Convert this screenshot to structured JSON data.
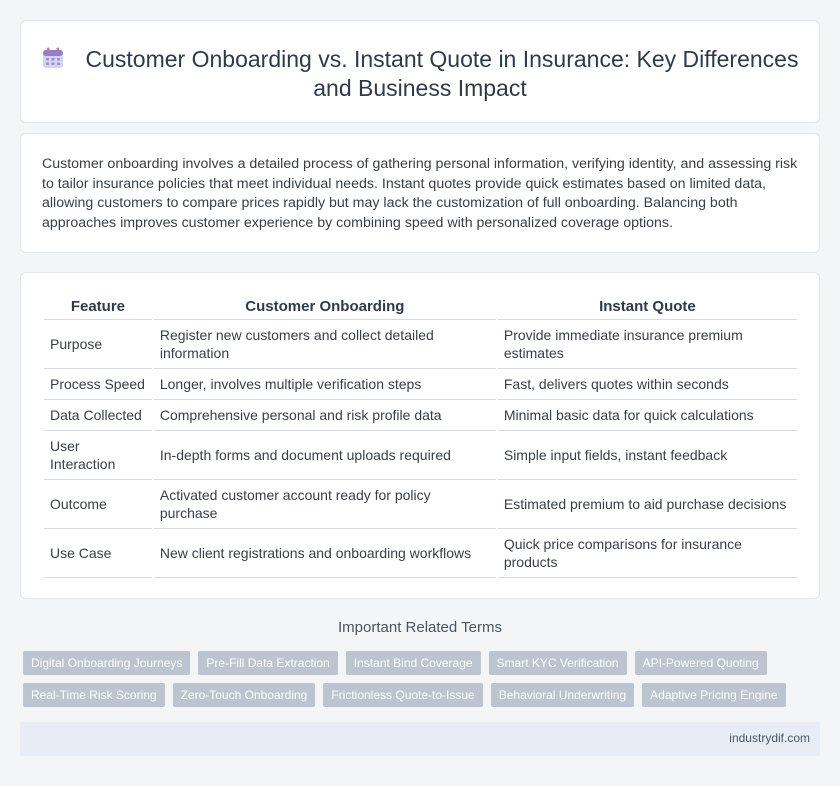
{
  "header": {
    "title": "Customer Onboarding vs. Instant Quote in Insurance: Key Differences and Business Impact",
    "icon": "calendar-icon"
  },
  "intro": {
    "text": "Customer onboarding involves a detailed process of gathering personal information, verifying identity, and assessing risk to tailor insurance policies that meet individual needs. Instant quotes provide quick estimates based on limited data, allowing customers to compare prices rapidly but may lack the customization of full onboarding. Balancing both approaches improves customer experience by combining speed with personalized coverage options."
  },
  "table": {
    "headers": [
      "Feature",
      "Customer Onboarding",
      "Instant Quote"
    ],
    "rows": [
      [
        "Purpose",
        "Register new customers and collect detailed information",
        "Provide immediate insurance premium estimates"
      ],
      [
        "Process Speed",
        "Longer, involves multiple verification steps",
        "Fast, delivers quotes within seconds"
      ],
      [
        "Data Collected",
        "Comprehensive personal and risk profile data",
        "Minimal basic data for quick calculations"
      ],
      [
        "User Interaction",
        "In-depth forms and document uploads required",
        "Simple input fields, instant feedback"
      ],
      [
        "Outcome",
        "Activated customer account ready for policy purchase",
        "Estimated premium to aid purchase decisions"
      ],
      [
        "Use Case",
        "New client registrations and onboarding workflows",
        "Quick price comparisons for insurance products"
      ]
    ]
  },
  "related": {
    "title": "Important Related Terms",
    "tags": [
      "Digital Onboarding Journeys",
      "Pre-Fill Data Extraction",
      "Instant Bind Coverage",
      "Smart KYC Verification",
      "API-Powered Quoting",
      "Real-Time Risk Scoring",
      "Zero-Touch Onboarding",
      "Frictionless Quote-to-Issue",
      "Behavioral Underwriting",
      "Adaptive Pricing Engine"
    ]
  },
  "footer": {
    "site": "industrydif.com"
  }
}
